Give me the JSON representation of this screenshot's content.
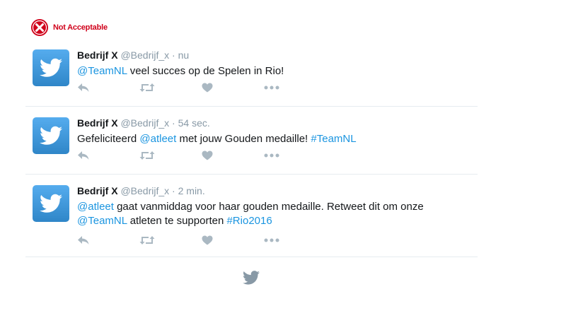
{
  "status": {
    "label": "Not Acceptable",
    "icon": "error-x-circle-icon",
    "color": "#d0021b"
  },
  "colors": {
    "link": "#1b95e0",
    "muted": "#8899a6",
    "text": "#14171a",
    "action_icon": "#aab8c2",
    "avatar": "#55acee"
  },
  "tweets": [
    {
      "name": "Bedrijf X",
      "handle": "@Bedrijf_x",
      "sep": "·",
      "time": "nu",
      "line1": [
        {
          "t": "@TeamNL",
          "link": true
        },
        {
          "t": " veel succes op de Spelen in Rio!",
          "link": false
        }
      ],
      "line2": []
    },
    {
      "name": "Bedrijf X",
      "handle": "@Bedrijf_x",
      "sep": "·",
      "time": "54 sec.",
      "line1": [
        {
          "t": "Gefeliciteerd ",
          "link": false
        },
        {
          "t": "@atleet",
          "link": true
        },
        {
          "t": " met jouw Gouden medaille! ",
          "link": false
        },
        {
          "t": "#TeamNL",
          "link": true
        }
      ],
      "line2": []
    },
    {
      "name": "Bedrijf X",
      "handle": "@Bedrijf_x",
      "sep": "·",
      "time": "2 min.",
      "line1": [
        {
          "t": "@atleet",
          "link": true
        },
        {
          "t": " gaat vanmiddag voor haar gouden medaille. Retweet dit om onze",
          "link": false
        }
      ],
      "line2": [
        {
          "t": "@TeamNL",
          "link": true
        },
        {
          "t": " atleten te supporten ",
          "link": false
        },
        {
          "t": "#Rio2016",
          "link": true
        }
      ]
    }
  ],
  "actions": [
    "reply-icon",
    "retweet-icon",
    "like-heart-icon",
    "more-dots-icon"
  ],
  "footer": {
    "icon": "twitter-bird-icon"
  }
}
